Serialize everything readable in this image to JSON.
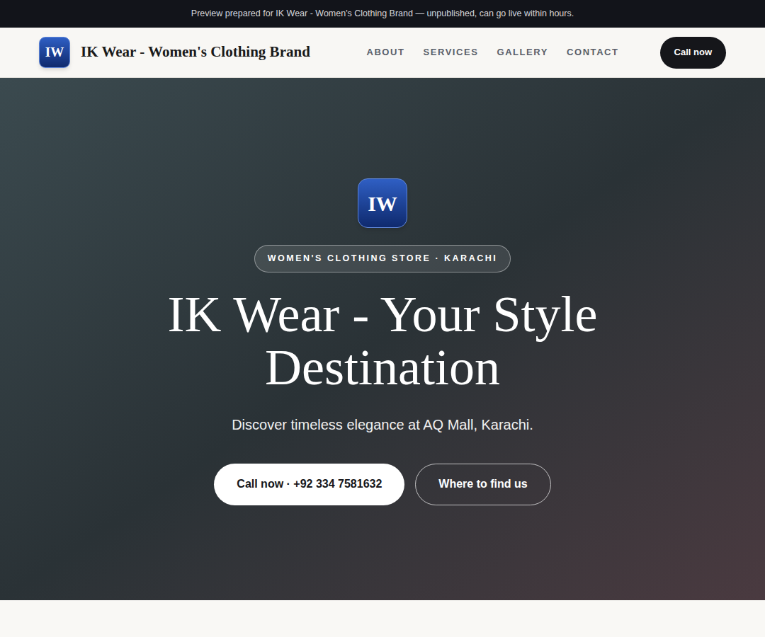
{
  "banner": {
    "text": "Preview prepared for IK Wear - Women's Clothing Brand — unpublished, can go live within hours."
  },
  "header": {
    "logo": "IW",
    "brand": "IK Wear - Women's Clothing Brand",
    "nav": [
      {
        "label": "ABOUT"
      },
      {
        "label": "SERVICES"
      },
      {
        "label": "GALLERY"
      },
      {
        "label": "CONTACT"
      }
    ],
    "cta": "Call now"
  },
  "hero": {
    "logo": "IW",
    "badge": "WOMEN'S CLOTHING STORE · KARACHI",
    "title": "IK Wear - Your Style Destination",
    "subtitle": "Discover timeless elegance at AQ Mall, Karachi.",
    "buttons": [
      {
        "label": "Call now · +92 334 7581632",
        "kind": "primary"
      },
      {
        "label": "Where to find us",
        "kind": "outline"
      }
    ]
  }
}
